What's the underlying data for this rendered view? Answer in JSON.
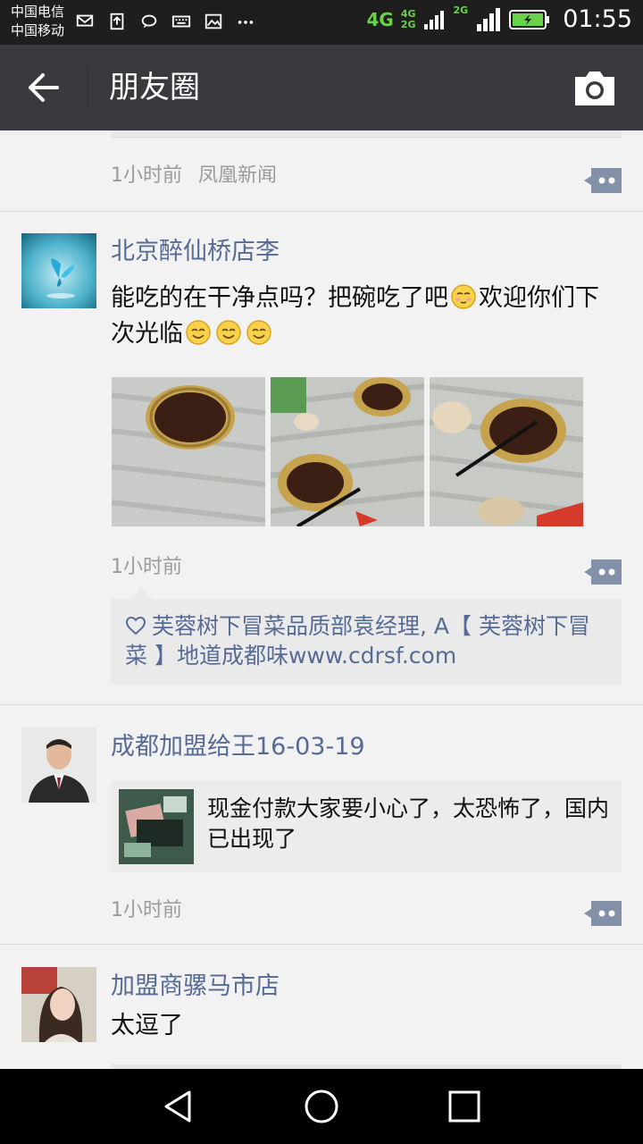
{
  "status_bar": {
    "carrier1": "中国电信",
    "carrier2": "中国移动",
    "net_type": "4G",
    "net_small_top": "4G",
    "net_small_bottom": "2G",
    "net_2g": "2G",
    "time": "01:55"
  },
  "header": {
    "title": "朋友圈"
  },
  "feed": {
    "prev_post": {
      "time": "1小时前",
      "source": "凤凰新闻"
    },
    "posts": [
      {
        "author": "北京醉仙桥店李",
        "text_part1": "能吃的在干净点吗？把碗吃了吧",
        "text_part2": "欢迎你们下次光临",
        "photos": [
          "bowl-photo-1",
          "bowl-photo-2",
          "bowl-photo-3"
        ],
        "time": "1小时前",
        "likes": "芙蓉树下冒菜品质部袁经理, A【 芙蓉树下冒菜 】地道成都味www.cdrsf.com"
      },
      {
        "author": "成都加盟给王16-03-19",
        "link_title": "现金付款大家要小心了，太恐怖了，国内已出现了",
        "time": "1小时前"
      },
      {
        "author": "加盟商骡马市店",
        "text": "太逗了"
      }
    ]
  },
  "colors": {
    "status_bg": "#1e1e1e",
    "titlebar_bg": "#393a3f",
    "name_link": "#576b95",
    "feed_bg": "#f2f2f2",
    "meta": "#9b9b9b"
  }
}
